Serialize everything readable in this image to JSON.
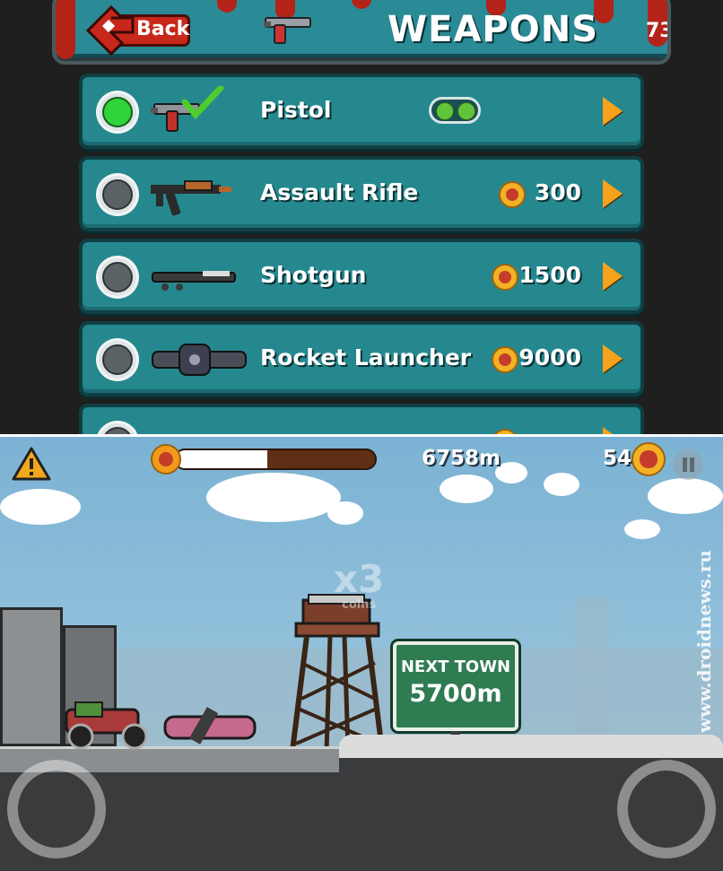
{
  "weapons_screen": {
    "back_label": "Back",
    "title": "WEAPONS",
    "coins": "73",
    "items": [
      {
        "name": "Pistol",
        "price": "",
        "selected": true,
        "owned": true
      },
      {
        "name": "Assault Rifle",
        "price": "300",
        "selected": false,
        "owned": false
      },
      {
        "name": "Shotgun",
        "price": "1500",
        "selected": false,
        "owned": false
      },
      {
        "name": "Rocket Launcher",
        "price": "9000",
        "selected": false,
        "owned": false
      }
    ]
  },
  "game_hud": {
    "distance": "6758m",
    "coins": "54",
    "progress": 0.46,
    "multiplier": "x3",
    "multiplier_unit": "coins"
  },
  "scene": {
    "sign_line1": "NEXT TOWN",
    "sign_line2": "5700m"
  },
  "watermark": "www.droidnews.ru",
  "colors": {
    "panel_teal": "#25888f",
    "header_red": "#c8271b",
    "coin_gold": "#f3b224",
    "arrow_orange": "#f7a21b",
    "sign_green": "#2f7b52"
  },
  "icons": [
    "back-arrow-icon",
    "pistol-icon",
    "checkmark-icon",
    "assault-rifle-icon",
    "shotgun-icon",
    "rocket-launcher-icon",
    "coin-icon",
    "warning-icon",
    "pause-icon"
  ]
}
